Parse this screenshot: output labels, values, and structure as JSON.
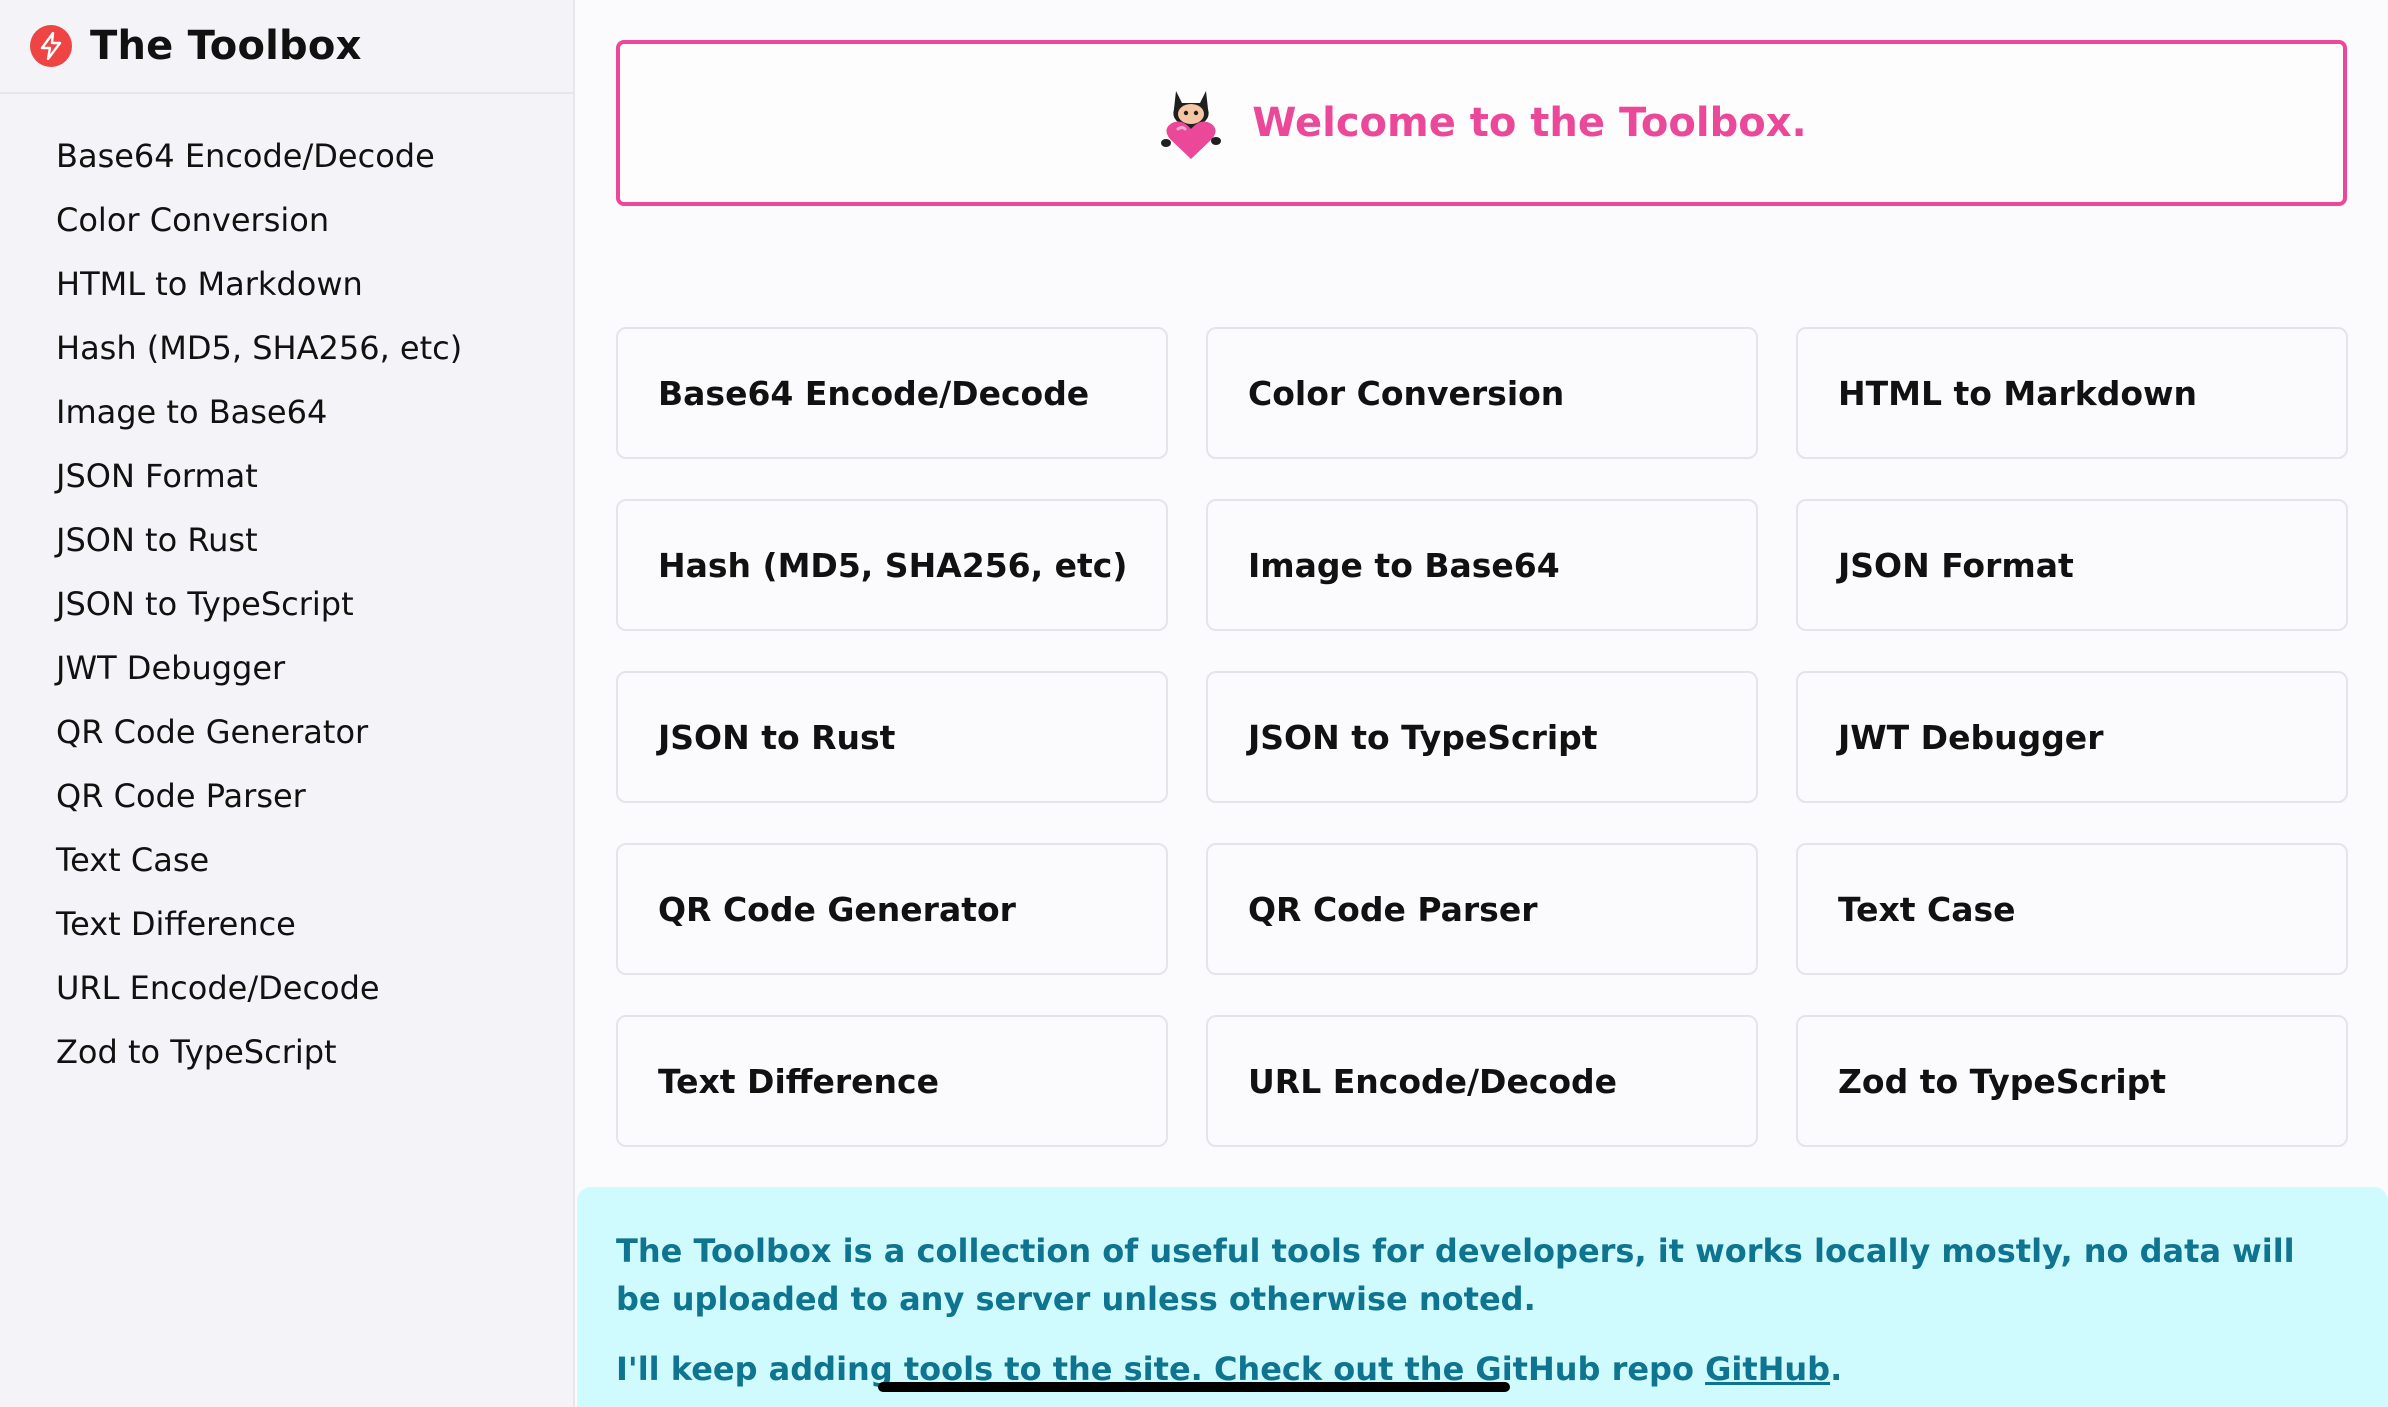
{
  "app": {
    "title": "The Toolbox",
    "accent": "#ec4899",
    "brand_icon_color": "#ef4444"
  },
  "sidebar": {
    "items": [
      {
        "label": "Base64 Encode/Decode"
      },
      {
        "label": "Color Conversion"
      },
      {
        "label": "HTML to Markdown"
      },
      {
        "label": "Hash (MD5, SHA256, etc)"
      },
      {
        "label": "Image to Base64"
      },
      {
        "label": "JSON Format"
      },
      {
        "label": "JSON to Rust"
      },
      {
        "label": "JSON to TypeScript"
      },
      {
        "label": "JWT Debugger"
      },
      {
        "label": "QR Code Generator"
      },
      {
        "label": "QR Code Parser"
      },
      {
        "label": "Text Case"
      },
      {
        "label": "Text Difference"
      },
      {
        "label": "URL Encode/Decode"
      },
      {
        "label": "Zod to TypeScript"
      }
    ]
  },
  "banner": {
    "text": "Welcome to the Toolbox.",
    "icon": "octocat-heart-icon"
  },
  "tools": [
    {
      "label": "Base64 Encode/Decode"
    },
    {
      "label": "Color Conversion"
    },
    {
      "label": "HTML to Markdown"
    },
    {
      "label": "Hash (MD5, SHA256, etc)"
    },
    {
      "label": "Image to Base64"
    },
    {
      "label": "JSON Format"
    },
    {
      "label": "JSON to Rust"
    },
    {
      "label": "JSON to TypeScript"
    },
    {
      "label": "JWT Debugger"
    },
    {
      "label": "QR Code Generator"
    },
    {
      "label": "QR Code Parser"
    },
    {
      "label": "Text Case"
    },
    {
      "label": "Text Difference"
    },
    {
      "label": "URL Encode/Decode"
    },
    {
      "label": "Zod to TypeScript"
    }
  ],
  "info": {
    "paragraph1": "The Toolbox is a collection of useful tools for developers, it works locally mostly, no data will be uploaded to any server unless otherwise noted.",
    "paragraph2_prefix": "I'll keep adding tools to the site. Check out the GitHub repo ",
    "paragraph2_link": "GitHub",
    "paragraph2_suffix": "."
  }
}
